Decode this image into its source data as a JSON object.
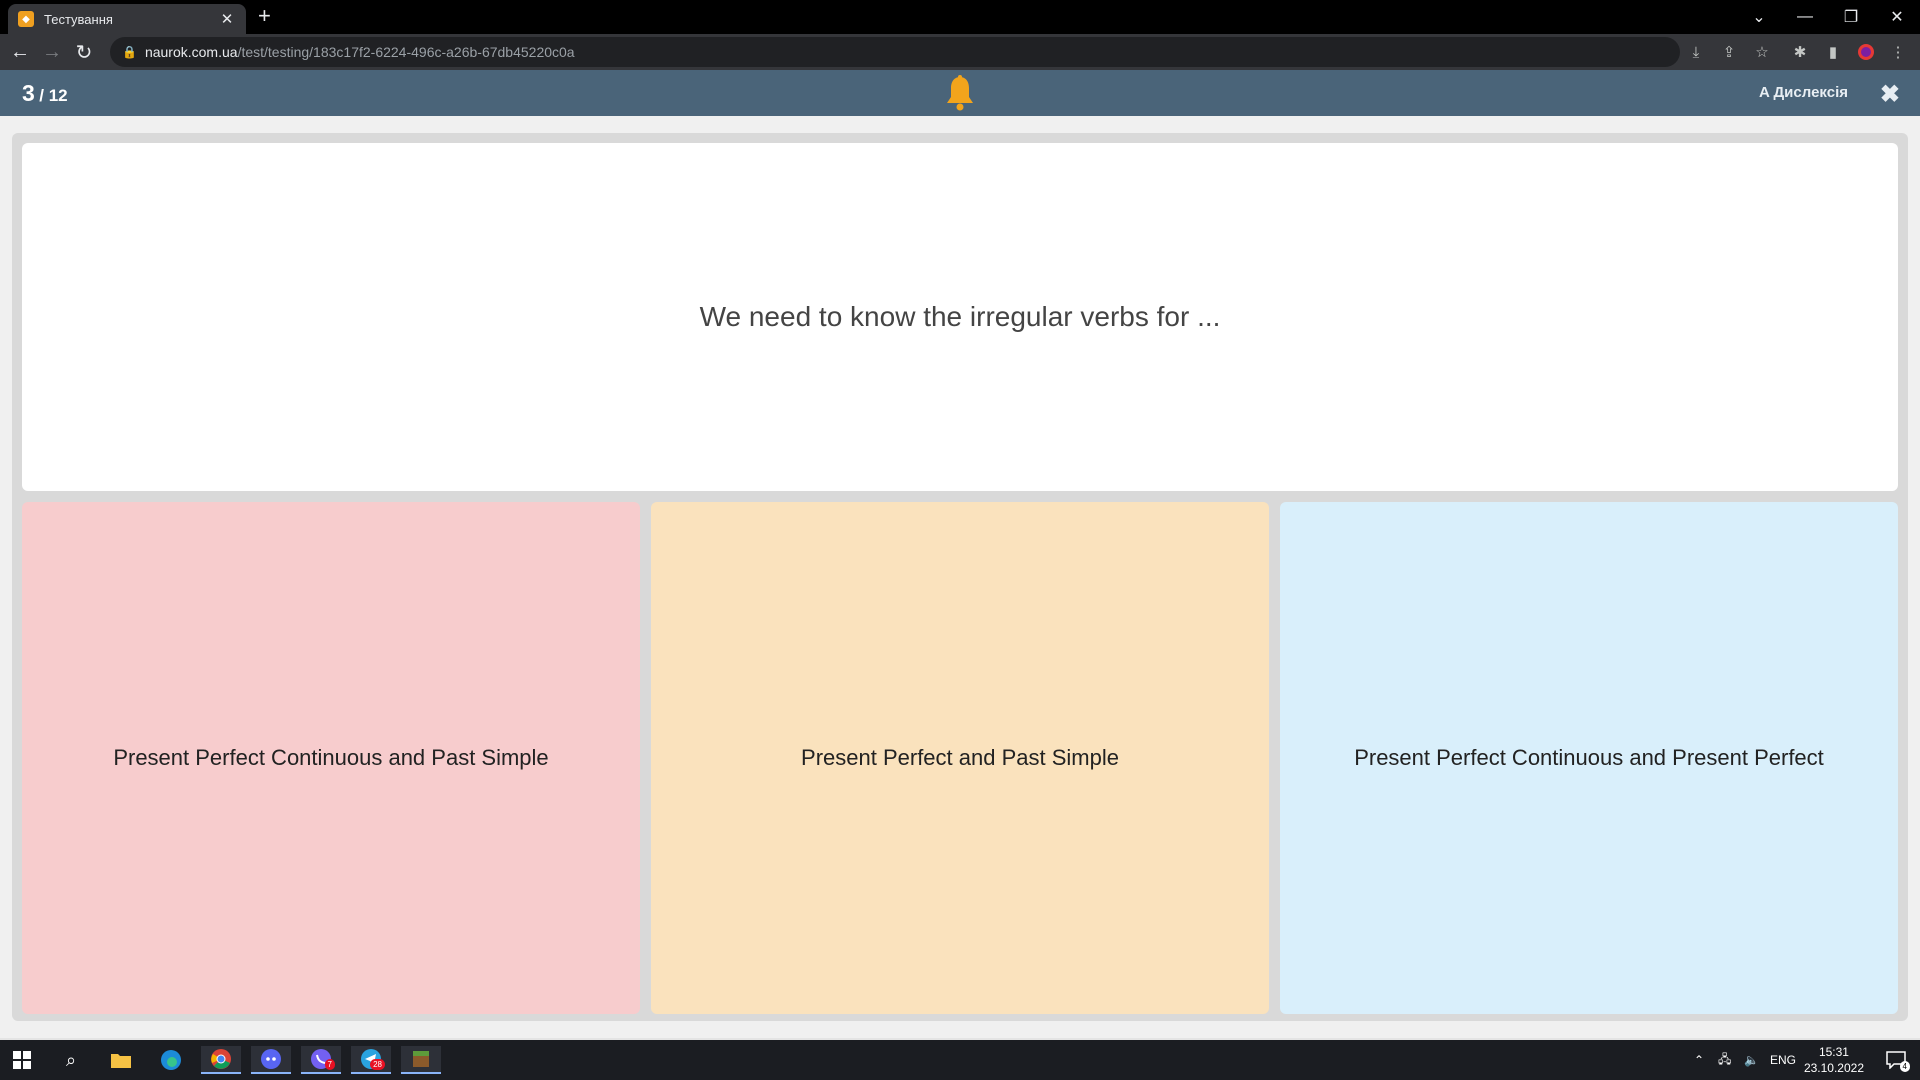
{
  "browser": {
    "tab_title": "Тестування",
    "url_host": "naurok.com.ua",
    "url_path": "/test/testing/183c17f2-6224-496c-a26b-67db45220c0a"
  },
  "header": {
    "current": "3",
    "total": "/ 12",
    "dyslexia_label": "A Дислексія",
    "bell_color": "#f0a020"
  },
  "question": {
    "text": "We need to know the irregular verbs for ..."
  },
  "answers": [
    {
      "label": "Present Perfect Continuous and Past Simple",
      "color": "#f7cccd"
    },
    {
      "label": "Present Perfect and Past Simple",
      "color": "#fae2bd"
    },
    {
      "label": "Present Perfect Continuous and Present Perfect",
      "color": "#d9effb"
    }
  ],
  "taskbar": {
    "language": "ENG",
    "time": "15:31",
    "date": "23.10.2022",
    "viber_badge": "7",
    "telegram_badge": "28",
    "notifications_badge": "4",
    "apps": [
      "start-icon",
      "search-icon",
      "file-explorer-icon",
      "edge-icon",
      "chrome-icon",
      "discord-icon",
      "viber-icon",
      "telegram-icon",
      "minecraft-icon"
    ]
  }
}
